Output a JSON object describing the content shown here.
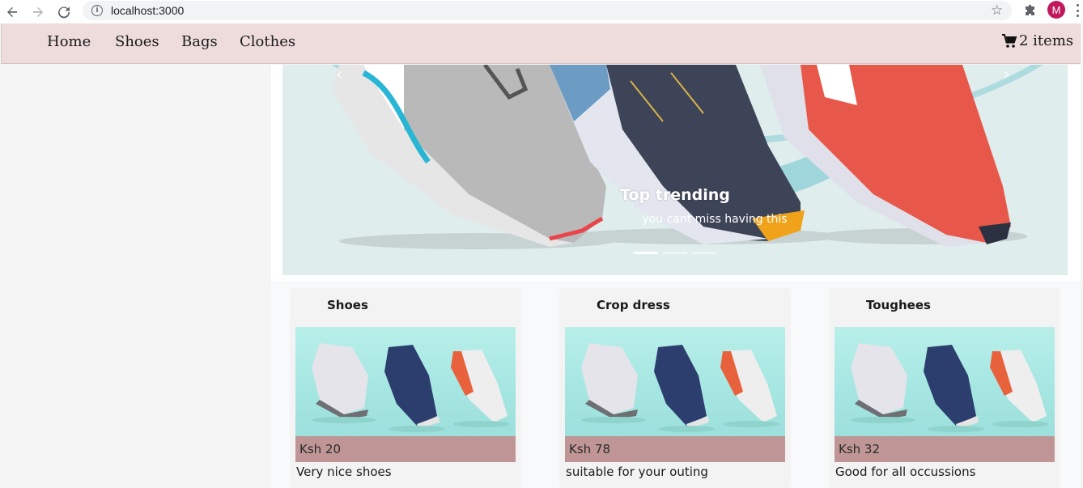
{
  "browser": {
    "url": "localhost:3000",
    "profile_initial": "M"
  },
  "nav": {
    "links": [
      "Home",
      "Shoes",
      "Bags",
      "Clothes"
    ],
    "cart_label": "2 items"
  },
  "carousel": {
    "title": "Top trending",
    "subtitle": "you cant miss having this",
    "slide_count": 3,
    "active_slide": 1
  },
  "products": [
    {
      "name": "Shoes",
      "price": "Ksh 20",
      "description": "Very nice shoes"
    },
    {
      "name": "Crop dress",
      "price": "Ksh 78",
      "description": "suitable for your outing"
    },
    {
      "name": "Toughees",
      "price": "Ksh 32",
      "description": "Good for all occussions"
    }
  ],
  "colors": {
    "nav_bg": "#eddcdb",
    "price_bar": "#bf9695",
    "avatar": "#c2185b"
  }
}
